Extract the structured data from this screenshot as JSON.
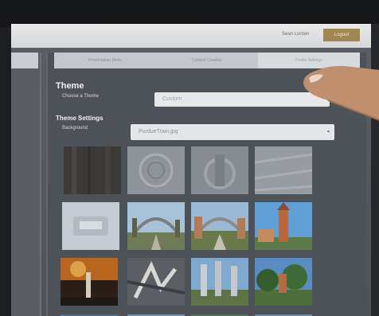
{
  "header": {
    "user_label": "Sean Lorden",
    "logout_label": "Logout"
  },
  "tabs": [
    {
      "label": "Presentation Mode",
      "active": false
    },
    {
      "label": "Content Creation",
      "active": false
    },
    {
      "label": "Profile Settings",
      "active": true
    }
  ],
  "theme": {
    "heading": "Theme",
    "choose_label": "Choose a Theme",
    "choose_value": "Custom"
  },
  "settings": {
    "heading": "Theme Settings",
    "background_label": "Background",
    "background_value": "PurdueTrain.jpg"
  },
  "grid": {
    "thumbnails": [
      {
        "name": "dark-wood-thumbnail"
      },
      {
        "name": "gray-texture-thumbnail"
      },
      {
        "name": "gray-pattern-thumbnail"
      },
      {
        "name": "gray-fabric-thumbnail"
      },
      {
        "name": "purdue-logo-thumbnail"
      },
      {
        "name": "campus-gateway-thumbnail"
      },
      {
        "name": "campus-arch-thumbnail"
      },
      {
        "name": "bell-tower-thumbnail"
      },
      {
        "name": "sunset-fountain-thumbnail"
      },
      {
        "name": "abstract-sculpture-thumbnail"
      },
      {
        "name": "campus-pillars-thumbnail"
      },
      {
        "name": "campus-trees-thumbnail"
      }
    ]
  },
  "colors": {
    "accent": "#a08752",
    "panel": "#4d5259",
    "topbar": "#dcdde0"
  }
}
